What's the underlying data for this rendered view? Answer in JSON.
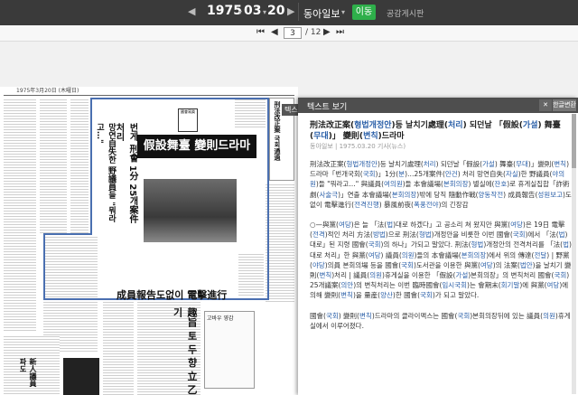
{
  "topbar": {
    "year": "1975",
    "month": "03",
    "day": "20",
    "newspaper": "동아일보",
    "go_label": "이동",
    "share_label": "공감게시판"
  },
  "pager": {
    "current_page": "3",
    "total_pages": "/ 12"
  },
  "newspaper_image": {
    "header_text": "1975年3月20日 (木曜日)",
    "headline": "假設舞臺 變則드라마",
    "sub_headline": "成員報告도없이 電擊進行",
    "vertical_head_1": "번게 刑會 1分 25개案件 처리",
    "vertical_head_2": "망연自失한 野議員들 \"뭐라고…\"",
    "vertical_head_3": "刑法改正案 국회通過",
    "vertical_head_4": "新人議員 파도",
    "vertical_head_5": "趣旨 토 두 향 立 乙 기",
    "stamp_text": "國會寫眞",
    "cartoon_title": "고바우 영감"
  },
  "panel": {
    "title": "텍스트 보기",
    "close_label": "닫기",
    "toggle_label": "한글변환",
    "side_tab": "텍스"
  },
  "article": {
    "title_parts": [
      {
        "text": "刑法改正案(",
        "blue": false
      },
      {
        "text": "형법개정안",
        "blue": true
      },
      {
        "text": ")등 날치기處理(",
        "blue": false
      },
      {
        "text": "처리",
        "blue": true
      },
      {
        "text": ") 되던날 「假設(",
        "blue": false
      },
      {
        "text": "가설",
        "blue": true
      },
      {
        "text": ") 舞臺(",
        "blue": false
      },
      {
        "text": "무대",
        "blue": true
      },
      {
        "text": ")」 變則(",
        "blue": false
      },
      {
        "text": "변칙",
        "blue": true
      },
      {
        "text": ")드라마",
        "blue": false
      }
    ],
    "meta": "동아일보 | 1975.03.20 기사(뉴스)",
    "paragraphs": [
      [
        {
          "text": "刑法改正案(",
          "blue": false
        },
        {
          "text": "형법개정안",
          "blue": true
        },
        {
          "text": ")등 날치기處理(",
          "blue": false
        },
        {
          "text": "처리",
          "blue": true
        },
        {
          "text": ") 되던날「假設(",
          "blue": false
        },
        {
          "text": "가설",
          "blue": true
        },
        {
          "text": ") 舞臺(",
          "blue": false
        },
        {
          "text": "무대",
          "blue": true
        },
        {
          "text": ")」變則(",
          "blue": false
        },
        {
          "text": "변칙",
          "blue": true
        },
        {
          "text": ")드라마「번개국회(",
          "blue": false
        },
        {
          "text": "국회",
          "blue": true
        },
        {
          "text": ")」1分(",
          "blue": false
        },
        {
          "text": "분",
          "blue": true
        },
        {
          "text": ")…25개案件(",
          "blue": false
        },
        {
          "text": "안건",
          "blue": true
        },
        {
          "text": ") 처리 망연自失(",
          "blue": false
        },
        {
          "text": "자실",
          "blue": true
        },
        {
          "text": ")한 野議員(",
          "blue": false
        },
        {
          "text": "야의원",
          "blue": true
        },
        {
          "text": ")들 \"뭐라고…\" 與議員(",
          "blue": false
        },
        {
          "text": "여의원",
          "blue": true
        },
        {
          "text": ")들 本會議場(",
          "blue": false
        },
        {
          "text": "본회의장",
          "blue": true
        },
        {
          "text": ") 별실에(",
          "blue": false
        },
        {
          "text": "잔호",
          "blue": true
        },
        {
          "text": ")로 휴게실집합「詐術劇(",
          "blue": false
        },
        {
          "text": "사술극",
          "blue": true
        },
        {
          "text": ")」연출 本會議場(",
          "blue": false
        },
        {
          "text": "본회의장",
          "blue": true
        },
        {
          "text": ")밖에 당직 隨動作戰(",
          "blue": false
        },
        {
          "text": "양동작전",
          "blue": true
        },
        {
          "text": ") 成員報告(",
          "blue": false
        },
        {
          "text": "성원보고",
          "blue": true
        },
        {
          "text": ")도없이 電擊進行(",
          "blue": false
        },
        {
          "text": "전격진행",
          "blue": true
        },
        {
          "text": ") 暴風前夜(",
          "blue": false
        },
        {
          "text": "폭풍전야",
          "blue": true
        },
        {
          "text": ")의 긴장감",
          "blue": false
        }
      ],
      [
        {
          "text": "○—與黨(",
          "blue": false
        },
        {
          "text": "여당",
          "blue": true
        },
        {
          "text": ")은 늘 「法(",
          "blue": false
        },
        {
          "text": "법",
          "blue": true
        },
        {
          "text": ")대로 하겠다」고 공소리 쳐 왔지만 與黨(",
          "blue": false
        },
        {
          "text": "여당",
          "blue": true
        },
        {
          "text": ")은 19日 電擊(",
          "blue": false
        },
        {
          "text": "전격",
          "blue": true
        },
        {
          "text": ")적인 처리 方法(",
          "blue": false
        },
        {
          "text": "방법",
          "blue": true
        },
        {
          "text": ")으로 刑法(",
          "blue": false
        },
        {
          "text": "형법",
          "blue": true
        },
        {
          "text": ")개정안을 비롯한 이번 國會(",
          "blue": false
        },
        {
          "text": "국회",
          "blue": true
        },
        {
          "text": ")에서 「法(",
          "blue": false
        },
        {
          "text": "법",
          "blue": true
        },
        {
          "text": ")대로」된 지령 國會(",
          "blue": false
        },
        {
          "text": "국회",
          "blue": true
        },
        {
          "text": ")의 하나」가되고 말았다. 刑法(",
          "blue": false
        },
        {
          "text": "형법",
          "blue": true
        },
        {
          "text": ")개정안의 전격처리를 「法(",
          "blue": false
        },
        {
          "text": "법",
          "blue": true
        },
        {
          "text": ")대로 처리」한 與黨(",
          "blue": false
        },
        {
          "text": "여당",
          "blue": true
        },
        {
          "text": ") 議員(",
          "blue": false
        },
        {
          "text": "의원",
          "blue": true
        },
        {
          "text": ")들의 本會議場(",
          "blue": false
        },
        {
          "text": "본회의장",
          "blue": true
        },
        {
          "text": ")에서 위의 傳達(",
          "blue": false
        },
        {
          "text": "전달",
          "blue": true
        },
        {
          "text": ") | 野黨(",
          "blue": false
        },
        {
          "text": "야당",
          "blue": true
        },
        {
          "text": ")의員 본회의場 등을 國會(",
          "blue": false
        },
        {
          "text": "국회",
          "blue": true
        },
        {
          "text": ")도서관을 이용한 與黨(",
          "blue": false
        },
        {
          "text": "여당",
          "blue": true
        },
        {
          "text": ")의 法案(",
          "blue": false
        },
        {
          "text": "법안",
          "blue": true
        },
        {
          "text": ")을 날치기 變則(",
          "blue": false
        },
        {
          "text": "변칙",
          "blue": true
        },
        {
          "text": ")처리 | 議員(",
          "blue": false
        },
        {
          "text": "의원",
          "blue": true
        },
        {
          "text": ")휴게실을 이용한 「假設(",
          "blue": false
        },
        {
          "text": "가설",
          "blue": true
        },
        {
          "text": ")본회의장」의 변칙처리 國會(",
          "blue": false
        },
        {
          "text": "국회",
          "blue": true
        },
        {
          "text": ") 25개議案(",
          "blue": false
        },
        {
          "text": "의안",
          "blue": true
        },
        {
          "text": ")의 변칙처리는 이번 臨時國會(",
          "blue": false
        },
        {
          "text": "임시국회",
          "blue": true
        },
        {
          "text": ")는 會期末(",
          "blue": false
        },
        {
          "text": "회기말",
          "blue": true
        },
        {
          "text": ")에 與黨(",
          "blue": false
        },
        {
          "text": "여당",
          "blue": true
        },
        {
          "text": ")에 의해 變則(",
          "blue": false
        },
        {
          "text": "변칙",
          "blue": true
        },
        {
          "text": ")을 量産(",
          "blue": false
        },
        {
          "text": "양산",
          "blue": true
        },
        {
          "text": ")한 國會(",
          "blue": false
        },
        {
          "text": "국회",
          "blue": true
        },
        {
          "text": ")가 되고 말았다.",
          "blue": false
        }
      ],
      [
        {
          "text": "國會(",
          "blue": false
        },
        {
          "text": "국회",
          "blue": true
        },
        {
          "text": ") 變則(",
          "blue": false
        },
        {
          "text": "변칙",
          "blue": true
        },
        {
          "text": ")드라마의 클라이맥스는 國會(",
          "blue": false
        },
        {
          "text": "국회",
          "blue": true
        },
        {
          "text": ")본회의장뒤에 있는 議員(",
          "blue": false
        },
        {
          "text": "의원",
          "blue": true
        },
        {
          "text": ")휴게실에서 이루어졌다.",
          "blue": false
        }
      ]
    ]
  },
  "colors": {
    "topbar": "#3a3a3a",
    "go_button": "#2eaf4a",
    "link_blue": "#2a5fa8",
    "panel_head": "#4e4e4e"
  }
}
